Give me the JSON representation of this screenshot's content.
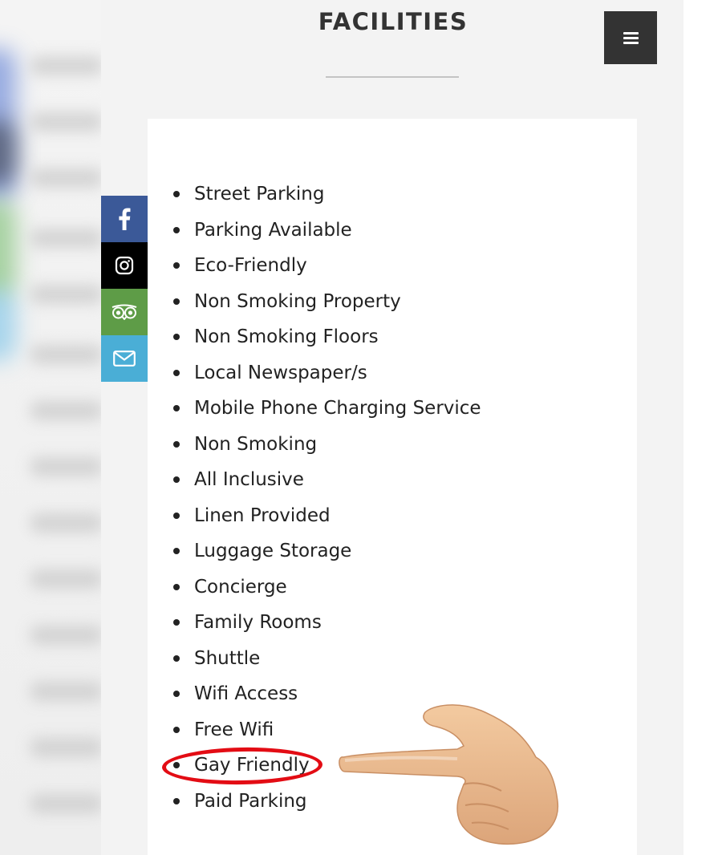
{
  "section": {
    "title": "FACILITIES"
  },
  "menu": {
    "icon": "hamburger-menu-icon"
  },
  "social_links": [
    {
      "name": "facebook",
      "icon": "facebook-icon",
      "color": "#3b5998"
    },
    {
      "name": "instagram",
      "icon": "instagram-icon",
      "color": "#000000"
    },
    {
      "name": "tripadvisor",
      "icon": "tripadvisor-owl-icon",
      "color": "#5e9c47"
    },
    {
      "name": "email",
      "icon": "envelope-icon",
      "color": "#4aaed6"
    }
  ],
  "facilities": [
    "Street Parking",
    "Parking Available",
    "Eco-Friendly",
    "Non Smoking Property",
    "Non Smoking Floors",
    "Local Newspaper/s",
    "Mobile Phone Charging Service",
    "Non Smoking",
    "All Inclusive",
    "Linen Provided",
    "Luggage Storage",
    "Concierge",
    "Family Rooms",
    "Shuttle",
    "Wifi Access",
    "Free Wifi",
    "Gay Friendly",
    "Paid Parking"
  ],
  "highlighted_facility": "Gay Friendly",
  "annotation": {
    "icon": "pointing-hand-icon",
    "ring_color": "#e30c14"
  }
}
